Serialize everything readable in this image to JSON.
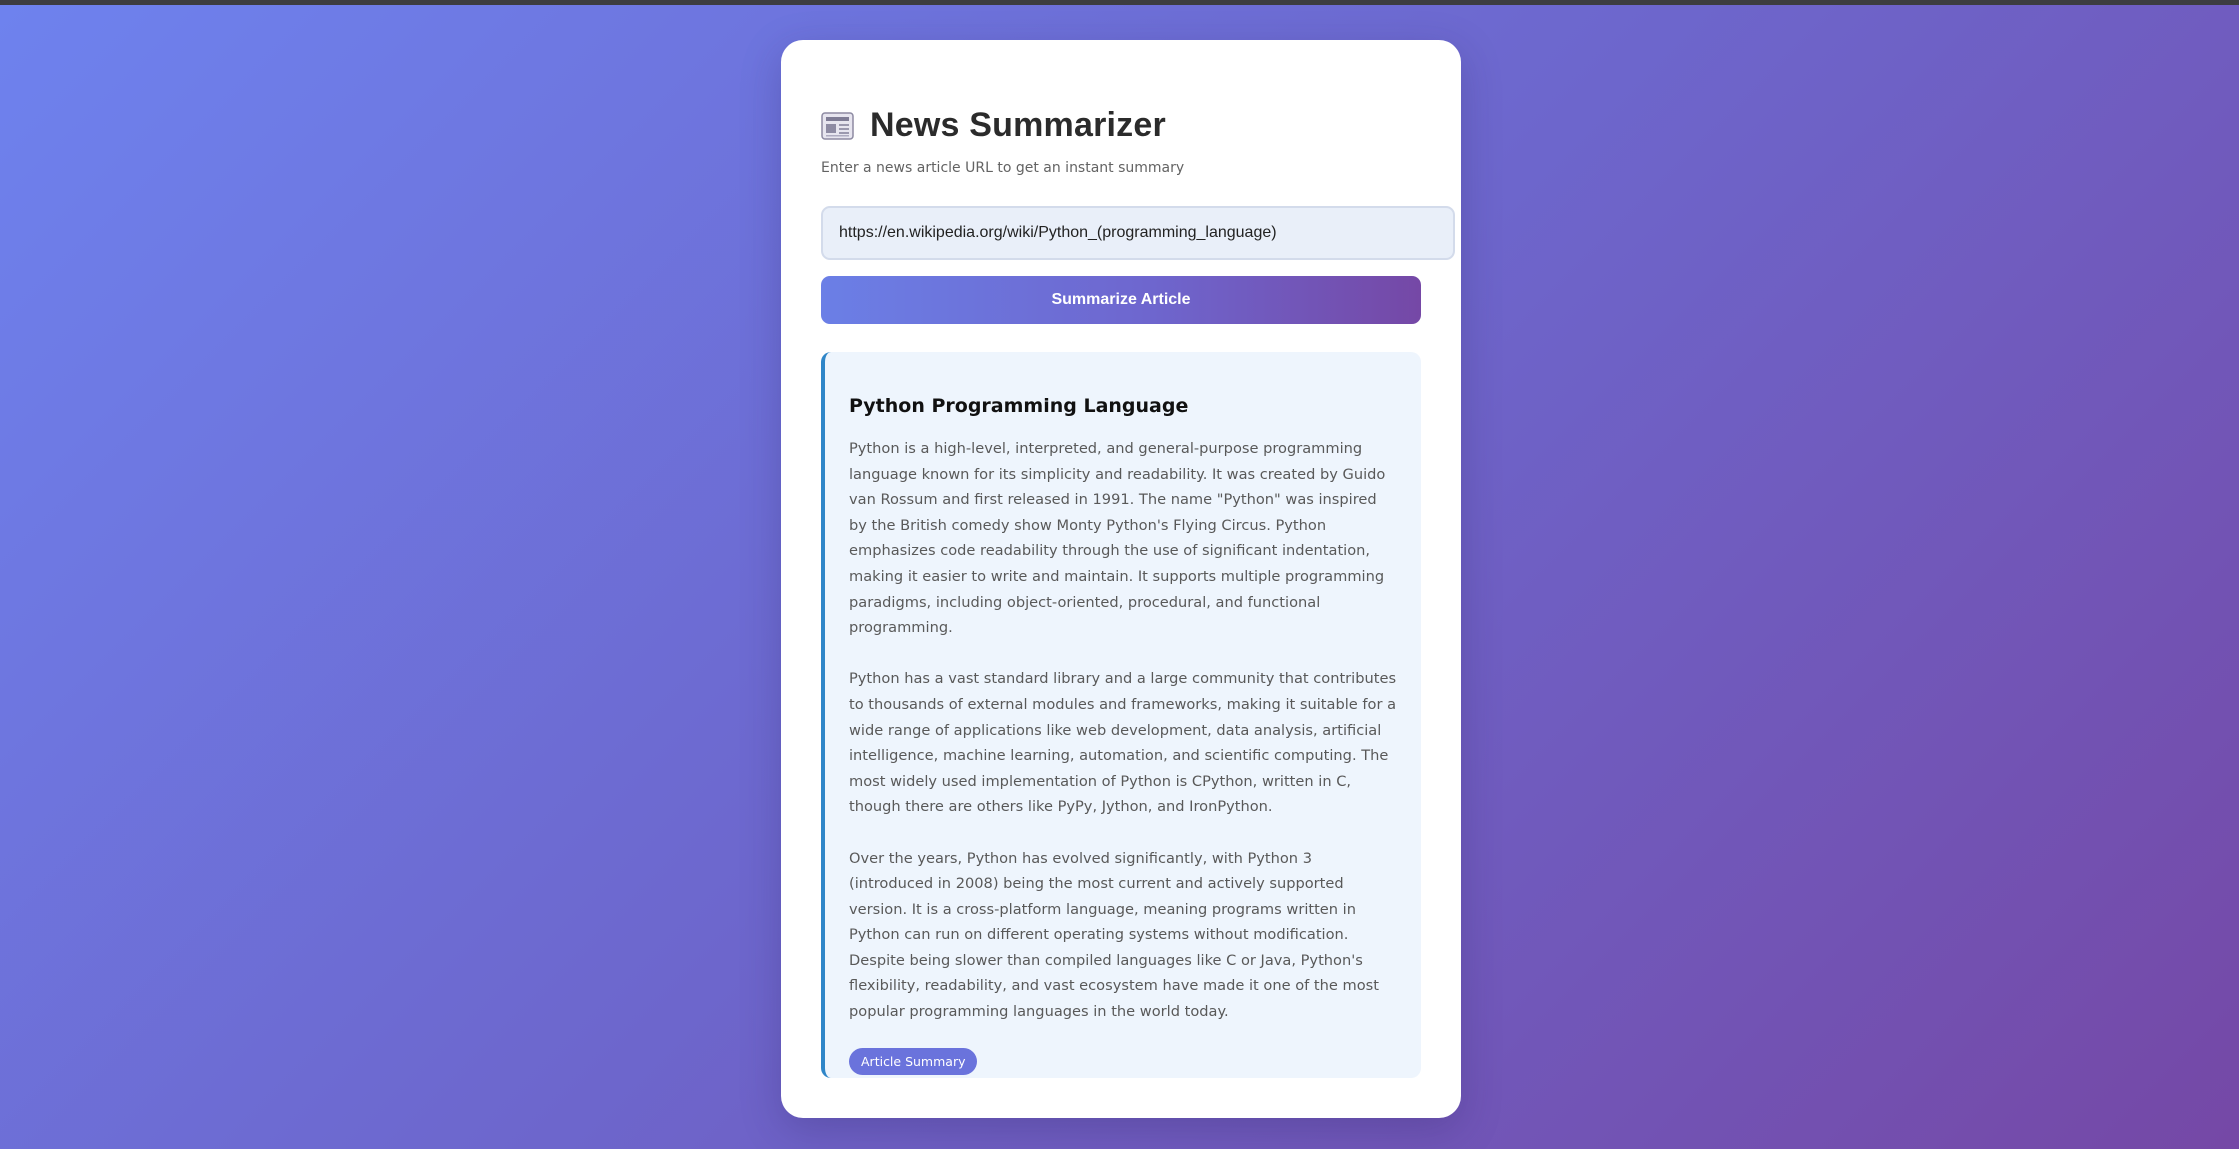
{
  "app": {
    "title": "News Summarizer",
    "icon": "newspaper-icon",
    "subtitle": "Enter a news article URL to get an instant summary"
  },
  "form": {
    "url_value": "https://en.wikipedia.org/wiki/Python_(programming_language)",
    "submit_label": "Summarize Article"
  },
  "summary": {
    "title": "Python Programming Language",
    "paragraphs": [
      "Python is a high-level, interpreted, and general-purpose programming language known for its simplicity and readability. It was created by Guido van Rossum and first released in 1991. The name \"Python\" was inspired by the British comedy show Monty Python's Flying Circus. Python emphasizes code readability through the use of significant indentation, making it easier to write and maintain. It supports multiple programming paradigms, including object-oriented, procedural, and functional programming.",
      "Python has a vast standard library and a large community that contributes to thousands of external modules and frameworks, making it suitable for a wide range of applications like web development, data analysis, artificial intelligence, machine learning, automation, and scientific computing. The most widely used implementation of Python is CPython, written in C, though there are others like PyPy, Jython, and IronPython.",
      "Over the years, Python has evolved significantly, with Python 3 (introduced in 2008) being the most current and actively supported version. It is a cross-platform language, meaning programs written in Python can run on different operating systems without modification. Despite being slower than compiled languages like C or Java, Python's flexibility, readability, and vast ecosystem have made it one of the most popular programming languages in the world today."
    ],
    "badge": "Article Summary"
  },
  "colors": {
    "accent": "#6a73dc",
    "panel_border": "#2f86c8",
    "gradient_start": "#6e82ee",
    "gradient_end": "#7548a6"
  }
}
